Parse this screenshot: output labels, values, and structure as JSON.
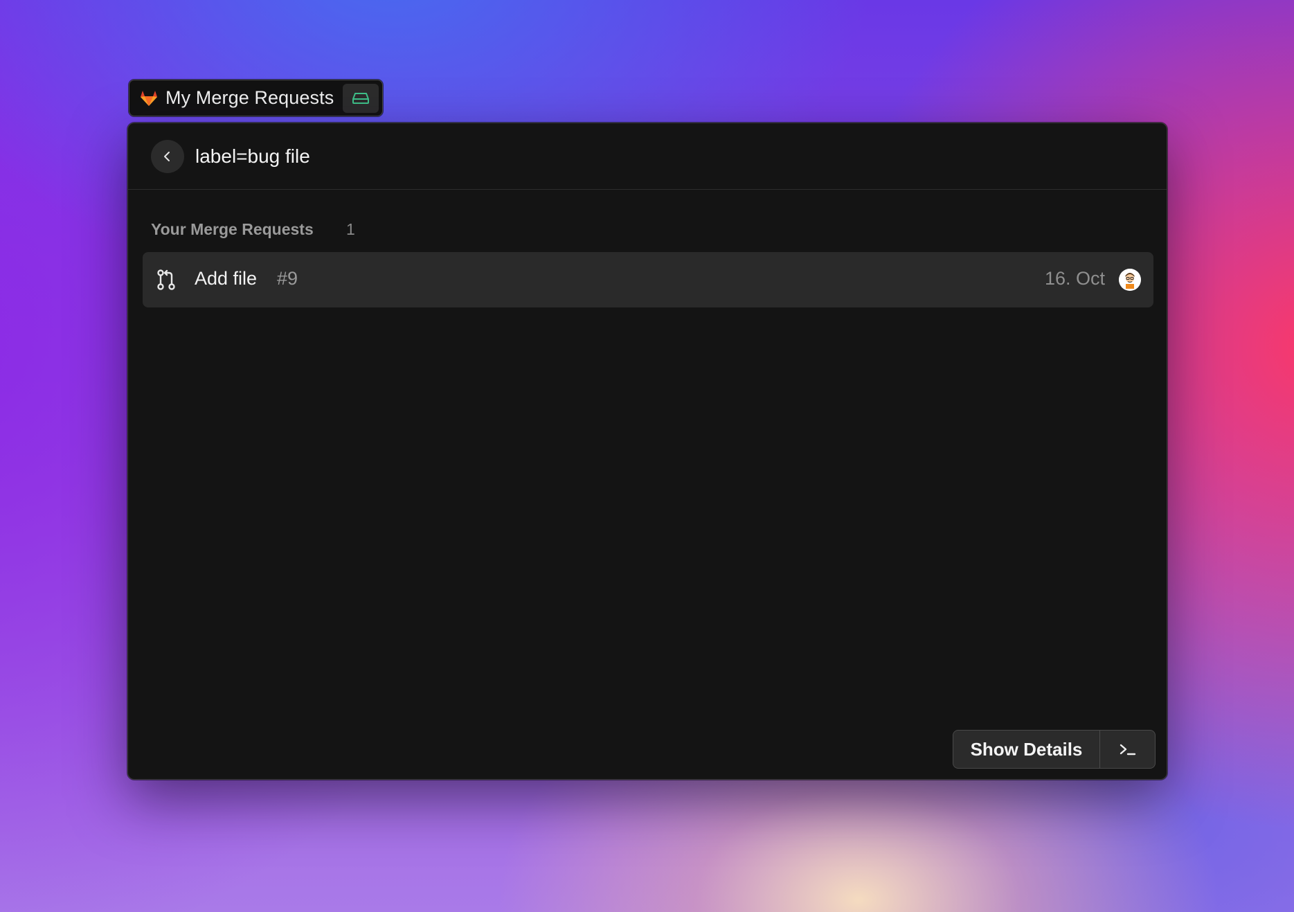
{
  "command": {
    "title": "My Merge Requests",
    "icon": "gitlab-fox-icon",
    "extension_icon": "disk-icon"
  },
  "search": {
    "value": "label=bug file",
    "back_icon": "chevron-left-icon"
  },
  "section": {
    "title": "Your Merge Requests",
    "count": "1"
  },
  "items": [
    {
      "icon": "merge-request-icon",
      "title": "Add file",
      "subtitle": "#9",
      "date": "16. Oct",
      "avatar": "user-avatar"
    }
  ],
  "actions": {
    "primary_label": "Show Details",
    "menu_icon": "terminal-prompt-icon"
  },
  "colors": {
    "window_bg": "#141414",
    "selected_row": "#2a2a2a",
    "fox_orange": "#e24329",
    "extension_green": "#3fc28a"
  }
}
